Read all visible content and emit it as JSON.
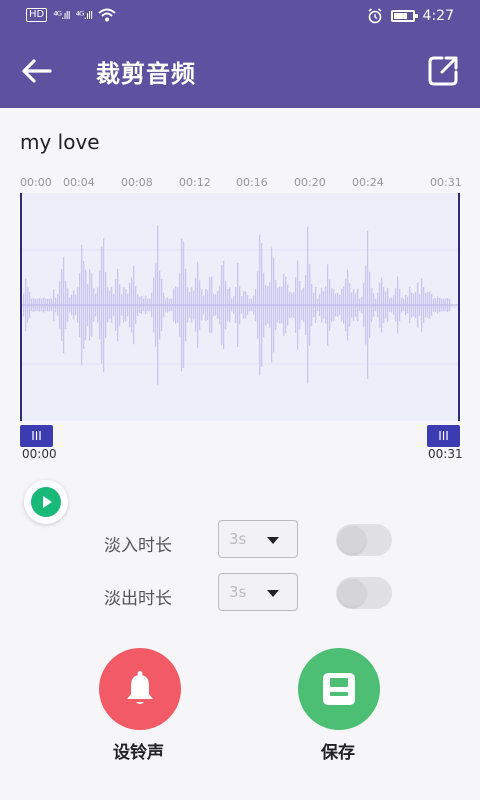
{
  "status_bar": {
    "hd_chip": "HD",
    "network1": "⁴ᴳ.ıll",
    "network2": "⁴ᴳ.ıll",
    "time": "4:27",
    "icons": [
      "wifi-icon",
      "alarm-icon",
      "battery-icon"
    ]
  },
  "app_bar": {
    "title": "裁剪音频",
    "back_icon": "arrow-left-icon",
    "action_icon": "share-external-icon"
  },
  "track": {
    "title": "my love"
  },
  "ruler": {
    "ticks": [
      "00:00",
      "00:04",
      "00:08",
      "00:12",
      "00:16",
      "00:20",
      "00:24",
      "00:31"
    ]
  },
  "trim": {
    "start_label": "00:00",
    "end_label": "00:31",
    "handle_glyph": "III",
    "selection_fraction": [
      0,
      1
    ]
  },
  "fade_in": {
    "label": "淡入时长",
    "value": "3s",
    "enabled": false
  },
  "fade_out": {
    "label": "淡出时长",
    "value": "3s",
    "enabled": false
  },
  "actions": {
    "ringtone_label": "设铃声",
    "save_label": "保存"
  },
  "colors": {
    "primary": "#5d51a0",
    "waveform": "#c9c5ef",
    "waveform_bg": "#eeeefb",
    "handle": "#3c3bb0",
    "play": "#19b97a",
    "ringtone": "#f25a66",
    "save": "#4dbf74"
  }
}
